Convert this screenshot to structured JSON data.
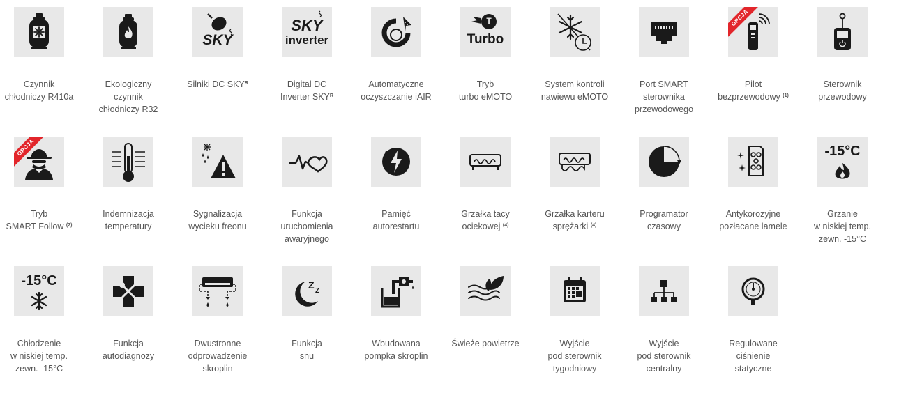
{
  "features": [
    {
      "key": "r410a",
      "icon": "gas-cylinder-snowflake-icon",
      "lines": [
        "Czynnik",
        "chłodniczy R410a"
      ]
    },
    {
      "key": "r32",
      "icon": "gas-cylinder-flame-icon",
      "lines": [
        "Ekologiczny",
        "czynnik",
        "chłodniczy R32"
      ]
    },
    {
      "key": "sky-dc",
      "icon": "sky-motor-icon",
      "icon_text": "SKY",
      "lines": [
        "Silniki DC SKY"
      ],
      "sup": "R"
    },
    {
      "key": "sky-inverter",
      "icon": "sky-inverter-icon",
      "icon_text": "SKY",
      "icon_text2": "inverter",
      "lines": [
        "Digital DC",
        "Inverter SKY"
      ],
      "sup": "R"
    },
    {
      "key": "iair",
      "icon": "iair-cleaning-icon",
      "lines": [
        "Automatyczne",
        "oczyszczanie iAIR"
      ]
    },
    {
      "key": "turbo",
      "icon": "turbo-icon",
      "icon_text": "Turbo",
      "icon_badge": "T",
      "lines": [
        "Tryb",
        "turbo eMOTO"
      ]
    },
    {
      "key": "freeze-control",
      "icon": "snowflake-clock-icon",
      "lines": [
        "System kontroli",
        "nawiewu eMOTO"
      ]
    },
    {
      "key": "smart-port",
      "icon": "ethernet-port-icon",
      "lines": [
        "Port SMART",
        "sterownika",
        "przewodowego"
      ]
    },
    {
      "key": "remote",
      "icon": "wireless-remote-icon",
      "badge": "OPCJA",
      "lines": [
        "Pilot",
        "bezprzewodowy"
      ],
      "sup": "(1)"
    },
    {
      "key": "wired",
      "icon": "wired-controller-icon",
      "lines": [
        "Sterownik",
        "przewodowy"
      ]
    },
    {
      "key": "follow",
      "icon": "spy-icon",
      "badge": "OPCJA",
      "lines": [
        "Tryb",
        "SMART Follow"
      ],
      "sup": "(2)"
    },
    {
      "key": "temp",
      "icon": "thermometer-icon",
      "lines": [
        "Indemnizacja",
        "temperatury"
      ]
    },
    {
      "key": "leak",
      "icon": "leak-warning-icon",
      "lines": [
        "Sygnalizacja",
        "wycieku freonu"
      ]
    },
    {
      "key": "emergency",
      "icon": "heartbeat-icon",
      "lines": [
        "Funkcja",
        "uruchomienia",
        "awaryjnego"
      ]
    },
    {
      "key": "memory",
      "icon": "power-restart-icon",
      "lines": [
        "Pamięć",
        "autorestartu"
      ]
    },
    {
      "key": "tray-heater",
      "icon": "tray-heater-icon",
      "lines": [
        "Grzałka tacy",
        "ociekowej"
      ],
      "sup": "(4)"
    },
    {
      "key": "crank-heater",
      "icon": "crankcase-heater-icon",
      "lines": [
        "Grzałka karteru",
        "sprężarki"
      ],
      "sup": "(4)"
    },
    {
      "key": "timer",
      "icon": "timer-pie-icon",
      "lines": [
        "Programator",
        "czasowy"
      ]
    },
    {
      "key": "gold-fins",
      "icon": "gold-fins-icon",
      "lines": [
        "Antykorozyjne",
        "pozłacane lamele"
      ]
    },
    {
      "key": "heat-low",
      "icon": "flame-icon",
      "icon_text": "-15°C",
      "lines": [
        "Grzanie",
        "w niskiej temp.",
        "zewn. -15°C"
      ]
    },
    {
      "key": "cool-low",
      "icon": "snowflake-icon",
      "icon_text": "-15°C",
      "lines": [
        "Chłodzenie",
        "w niskiej temp.",
        "zewn. -15°C"
      ]
    },
    {
      "key": "diag",
      "icon": "wrench-screwdriver-icon",
      "lines": [
        "Funkcja",
        "autodiagnozy"
      ]
    },
    {
      "key": "drain",
      "icon": "two-way-drain-icon",
      "lines": [
        "Dwustronne",
        "odprowadzenie",
        "skroplin"
      ]
    },
    {
      "key": "sleep",
      "icon": "moon-sleep-icon",
      "lines": [
        "Funkcja",
        "snu"
      ]
    },
    {
      "key": "pump",
      "icon": "condensate-pump-icon",
      "lines": [
        "Wbudowana",
        "pompka skroplin"
      ]
    },
    {
      "key": "fresh",
      "icon": "fresh-air-icon",
      "lines": [
        "Świeże powietrze"
      ]
    },
    {
      "key": "weekly",
      "icon": "calendar-icon",
      "lines": [
        "Wyjście",
        "pod sterownik",
        "tygodniowy"
      ]
    },
    {
      "key": "central",
      "icon": "network-icon",
      "lines": [
        "Wyjście",
        "pod sterownik",
        "centralny"
      ]
    },
    {
      "key": "pressure",
      "icon": "pressure-gauge-icon",
      "lines": [
        "Regulowane",
        "ciśnienie",
        "statyczne"
      ]
    }
  ]
}
